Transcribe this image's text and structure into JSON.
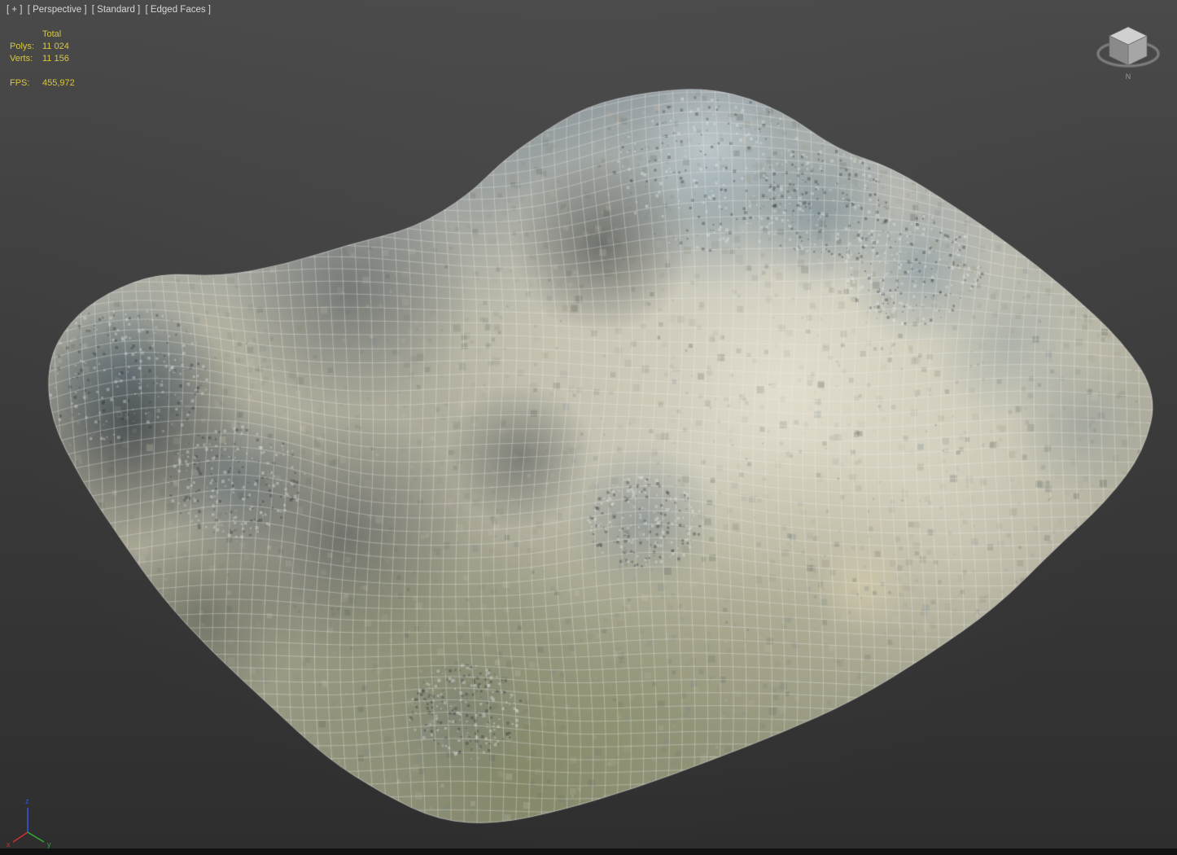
{
  "viewport": {
    "label_general": "[ + ]",
    "label_pov": "[ Perspective ]",
    "label_style": "[ Standard ]",
    "label_shading": "[ Edged Faces ]"
  },
  "stats": {
    "header": "Total",
    "polys_label": "Polys:",
    "polys_value": "11 024",
    "verts_label": "Verts:",
    "verts_value": "11 156",
    "fps_label": "FPS:",
    "fps_value": "455,972"
  },
  "viewcube": {
    "north": "N"
  },
  "axis": {
    "x": "x",
    "y": "y",
    "z": "z"
  },
  "theme": {
    "stats_color": "#d8c63e",
    "menu_color": "#d6d6d6",
    "wire_color": "#f2f2f2",
    "axis_x_color": "#cc3333",
    "axis_y_color": "#33aa33",
    "axis_z_color": "#3355dd"
  }
}
